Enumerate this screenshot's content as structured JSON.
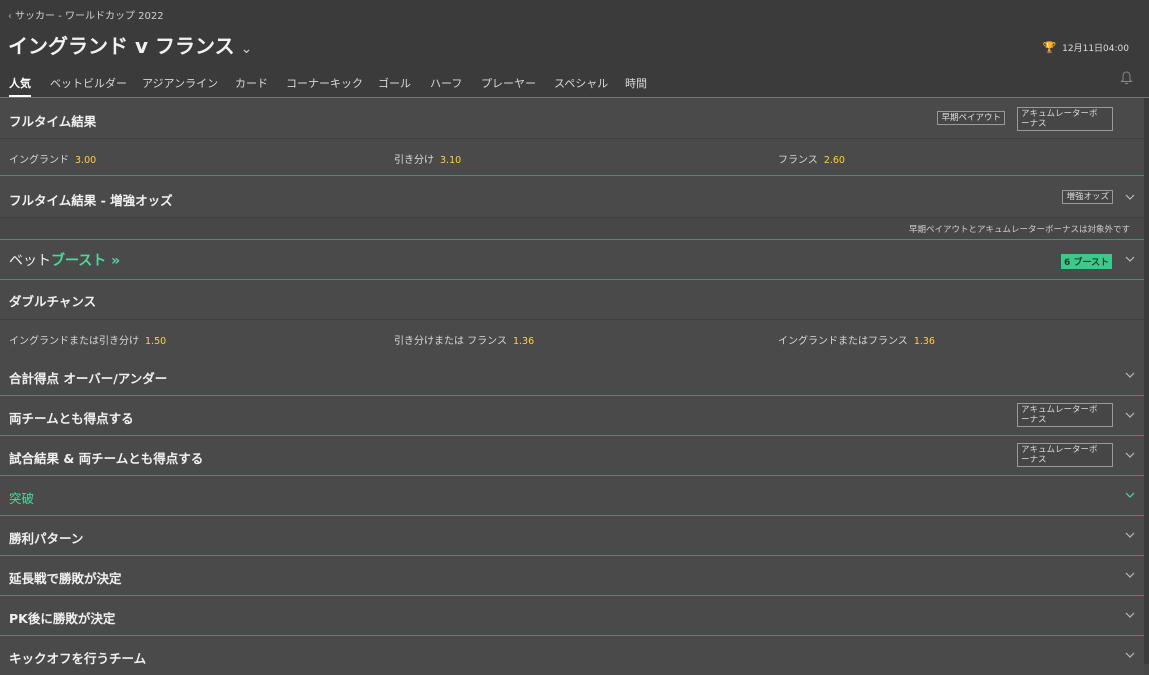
{
  "header": {
    "breadcrumb": "サッカー - ワールドカップ 2022",
    "title": "イングランド v フランス",
    "datetime": "12月11日04:00",
    "tabs": [
      "人気",
      "ベットビルダー",
      "アジアンライン",
      "カード",
      "コーナーキック",
      "ゴール",
      "ハーフ",
      "プレーヤー",
      "スペシャル",
      "時間"
    ]
  },
  "markets": {
    "fulltime": {
      "title": "フルタイム結果",
      "tag1": "早期ペイアウト",
      "tag2_line1": "アキュムレーターボ",
      "tag2_line2": "ーナス",
      "sel": [
        {
          "name": "イングランド",
          "odd": "3.00"
        },
        {
          "name": "引き分け",
          "odd": "3.10"
        },
        {
          "name": "フランス",
          "odd": "2.60"
        }
      ]
    },
    "boosted": {
      "title": "フルタイム結果 - 増強オッズ",
      "tag": "増強オッズ",
      "note": "早期ペイアウトとアキュムレーターボーナスは対象外です"
    },
    "betboost": {
      "title_a": "ベット",
      "title_b": "ブースト »",
      "badge": "6 ブースト"
    },
    "double": {
      "title": "ダブルチャンス",
      "sel": [
        {
          "name": "イングランドまたは引き分け",
          "odd": "1.50"
        },
        {
          "name": "引き分けまたは フランス",
          "odd": "1.36"
        },
        {
          "name": "イングランドまたはフランス",
          "odd": "1.36"
        }
      ]
    },
    "overunder": {
      "title": "合計得点 オーバー/アンダー"
    },
    "btts": {
      "title": "両チームとも得点する",
      "tag_line1": "アキュムレーターボ",
      "tag_line2": "ーナス"
    },
    "result_btts": {
      "title": "試合結果 & 両チームとも得点する",
      "tag_line1": "アキュムレーターボ",
      "tag_line2": "ーナス"
    },
    "toqualify": {
      "title": "突破"
    },
    "winpattern": {
      "title": "勝利パターン"
    },
    "extratime": {
      "title": "延長戦で勝敗が決定"
    },
    "penalties": {
      "title": "PK後に勝敗が決定"
    },
    "kickoff": {
      "title": "キックオフを行うチーム"
    }
  }
}
